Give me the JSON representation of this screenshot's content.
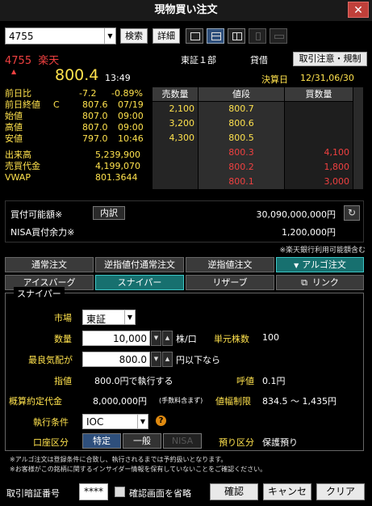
{
  "window": {
    "title": "現物買い注文",
    "close_glyph": "✕"
  },
  "toolbar": {
    "code_value": "4755",
    "search_label": "検索",
    "detail_label": "詳細"
  },
  "stock": {
    "code": "4755",
    "name": "楽天",
    "market": "東証１部",
    "lending": "貸借",
    "notice_button": "取引注意・規制",
    "price": "800.4",
    "price_time": "13:49",
    "settlement_label": "決算日",
    "settlement_date": "12/31,06/30"
  },
  "quotes": {
    "change_label": "前日比",
    "change": "-7.2",
    "change_pct": "-0.89%",
    "prev_close_label": "前日終値",
    "prev_close_flag": "C",
    "prev_close": "807.6",
    "prev_close_date": "07/19",
    "open_label": "始値",
    "open": "807.0",
    "open_time": "09:00",
    "high_label": "高値",
    "high": "807.0",
    "high_time": "09:00",
    "low_label": "安値",
    "low": "797.0",
    "low_time": "10:46",
    "volume_label": "出来高",
    "volume": "5,239,900",
    "turnover_label": "売買代金",
    "turnover": "4,199,070",
    "vwap_label": "VWAP",
    "vwap": "801.3644"
  },
  "board": {
    "ask_header": "売数量",
    "price_header": "値段",
    "bid_header": "買数量",
    "rows": [
      {
        "ask": "2,100",
        "price": "800.7",
        "bid": "",
        "side": "ask"
      },
      {
        "ask": "3,200",
        "price": "800.6",
        "bid": "",
        "side": "ask"
      },
      {
        "ask": "4,300",
        "price": "800.5",
        "bid": "",
        "side": "ask"
      },
      {
        "ask": "",
        "price": "800.3",
        "bid": "4,100",
        "side": "bid"
      },
      {
        "ask": "",
        "price": "800.2",
        "bid": "1,800",
        "side": "bid"
      },
      {
        "ask": "",
        "price": "800.1",
        "bid": "3,000",
        "side": "bid"
      }
    ]
  },
  "buying_power": {
    "label": "買付可能額※",
    "breakdown_label": "内訳",
    "value": "30,090,000,000円",
    "nisa_label": "NISA買付余力※",
    "nisa_value": "1,200,000円",
    "rakuten_note": "※楽天銀行利用可能額含む"
  },
  "tabs": {
    "normal": "通常注文",
    "stop": "逆指値付通常注文",
    "stop_only": "逆指値注文",
    "algo": "アルゴ注文",
    "iceberg": "アイスバーグ",
    "sniper": "スナイパー",
    "reserve": "リザーブ",
    "link": "リンク"
  },
  "form": {
    "title": "スナイパー",
    "market_label": "市場",
    "market_value": "東証",
    "qty_label": "数量",
    "qty_value": "10,000",
    "qty_unit": "株/口",
    "unit_label": "単元株数",
    "unit_value": "100",
    "best_quote_label": "最良気配が",
    "best_quote_value": "800.0",
    "best_quote_suffix": "円以下なら",
    "limit_label": "指値",
    "limit_value": "800.0円で執行する",
    "tick_label": "呼値",
    "tick_value": "0.1円",
    "estimate_label": "概算約定代金",
    "estimate_value": "8,000,000円",
    "estimate_note": "(手数料含まず)",
    "price_limit_label": "値幅制限",
    "price_limit_value": "834.5 ～ 1,435円",
    "exec_label": "執行条件",
    "exec_value": "IOC",
    "account_label": "口座区分",
    "account_specific": "特定",
    "account_general": "一般",
    "account_nisa": "NISA",
    "custody_label": "預り区分",
    "custody_value": "保護預り"
  },
  "notes": {
    "line1": "※アルゴ注文は登録条件に合致し、執行されるまでは予約扱いとなります。",
    "line2": "※お客様がこの銘柄に関するインサイダー情報を保有していないことをご確認ください。"
  },
  "footer": {
    "pin_label": "取引暗証番号",
    "pin_value": "****",
    "skip_confirm_label": "確認画面を省略",
    "confirm": "確認",
    "cancel": "キャンセル",
    "clear": "クリア"
  },
  "colors": {
    "accent_yellow": "#ffe24d",
    "accent_red": "#f04040",
    "tab_active": "#17706f"
  }
}
